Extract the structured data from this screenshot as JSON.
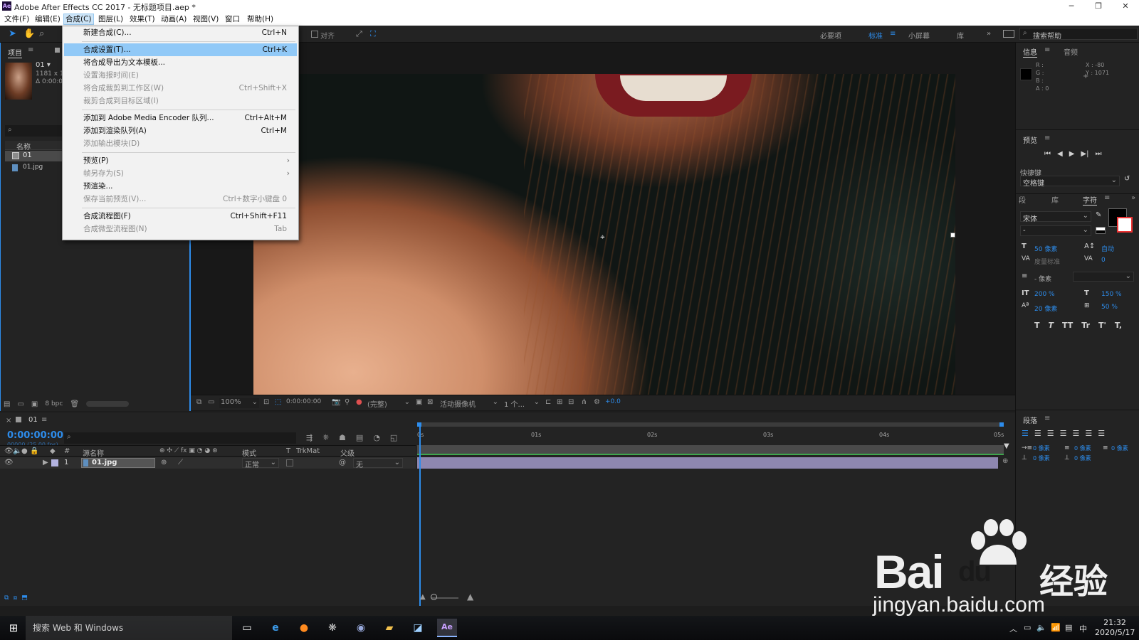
{
  "window": {
    "app_icon": "Ae",
    "title": "Adobe After Effects CC 2017 - 无标题项目.aep *",
    "minimize": "─",
    "maximize": "❐",
    "close": "✕"
  },
  "menubar": [
    "文件(F)",
    "编辑(E)",
    "合成(C)",
    "图层(L)",
    "效果(T)",
    "动画(A)",
    "视图(V)",
    "窗口",
    "帮助(H)"
  ],
  "toolbar": {
    "align_label": "对齐",
    "workspaces": [
      "必要项",
      "标准",
      "小屏幕",
      "库"
    ],
    "search_placeholder": "搜索帮助"
  },
  "composition_menu": {
    "items": [
      {
        "label": "新建合成(C)...",
        "shortcut": "Ctrl+N",
        "disabled": false
      },
      {
        "label": "合成设置(T)...",
        "shortcut": "Ctrl+K",
        "disabled": false,
        "highlighted": true
      },
      {
        "label": "将合成导出为文本模板...",
        "shortcut": "",
        "disabled": false
      },
      {
        "label": "设置海报时间(E)",
        "shortcut": "",
        "disabled": true
      },
      {
        "label": "将合成裁剪到工作区(W)",
        "shortcut": "Ctrl+Shift+X",
        "disabled": true
      },
      {
        "label": "裁剪合成到目标区域(I)",
        "shortcut": "",
        "disabled": true
      },
      {
        "label": "添加到 Adobe Media Encoder 队列...",
        "shortcut": "Ctrl+Alt+M",
        "disabled": false
      },
      {
        "label": "添加到渲染队列(A)",
        "shortcut": "Ctrl+M",
        "disabled": false
      },
      {
        "label": "添加输出模块(D)",
        "shortcut": "",
        "disabled": true
      },
      {
        "label": "预览(P)",
        "shortcut": "",
        "disabled": false,
        "submenu": true
      },
      {
        "label": "帧另存为(S)",
        "shortcut": "",
        "disabled": true,
        "submenu": true
      },
      {
        "label": "预渲染...",
        "shortcut": "",
        "disabled": false
      },
      {
        "label": "保存当前预览(V)...",
        "shortcut": "Ctrl+数字小键盘 0",
        "disabled": true
      },
      {
        "label": "合成流程图(F)",
        "shortcut": "Ctrl+Shift+F11",
        "disabled": false
      },
      {
        "label": "合成微型流程图(N)",
        "shortcut": "Tab",
        "disabled": true
      }
    ]
  },
  "project_panel": {
    "tab": "项目",
    "comp_name": "01 ▾",
    "comp_size": "1181 x 16",
    "comp_duration": "Δ 0:00:0",
    "name_header": "名称",
    "items": [
      {
        "name": "01",
        "type": "composition"
      },
      {
        "name": "01.jpg",
        "type": "image"
      }
    ],
    "bpc": "8 bpc"
  },
  "viewer_controls": {
    "zoom": "100%",
    "timecode": "0:00:00:00",
    "resolution": "(完整)",
    "camera": "活动摄像机",
    "views": "1 个...",
    "exposure": "+0.0"
  },
  "timeline": {
    "comp_tab": "01",
    "timecode": "0:00:00:00",
    "frame_info": "00000 (25.00 fps)",
    "columns": {
      "source_name": "源名称",
      "mode": "模式",
      "trkmat": "TrkMat",
      "parent": "父级",
      "track_t": "T"
    },
    "layers": [
      {
        "index": "1",
        "name": "01.jpg",
        "mode": "正常",
        "parent": "无"
      }
    ],
    "ruler": [
      "0s",
      "01s",
      "02s",
      "03s",
      "04s",
      "05s"
    ]
  },
  "info_panel": {
    "tabs": [
      "信息",
      "音频"
    ],
    "r": "R :",
    "g": "G :",
    "b": "B :",
    "a": "A : 0",
    "x": "X : -80",
    "y": "Y : 1071"
  },
  "preview_panel": {
    "title": "预览",
    "shortcut_label": "快捷键",
    "shortcut_value": "空格键"
  },
  "character_panel": {
    "tabs": [
      "段",
      "库",
      "字符"
    ],
    "font": "宋体",
    "style": "-",
    "size": "50 像素",
    "leading": "自动",
    "kerning": "度量标准",
    "tracking": "0",
    "stroke": "- 像素",
    "vscale": "200 %",
    "hscale": "150 %",
    "baseline": "20 像素",
    "tsume": "50 %",
    "styles": [
      "T",
      "T",
      "TT",
      "Tr",
      "T'",
      "T,"
    ]
  },
  "paragraph_panel": {
    "title": "段落",
    "indent_left": "0 像素",
    "indent_first": "0 像素",
    "indent_right": "0 像素",
    "space_before": "0 像素",
    "space_after": "0 像素"
  },
  "taskbar": {
    "search": "搜索 Web 和 Windows",
    "ime": "中",
    "time": "21:32",
    "date": "2020/5/17"
  },
  "watermark": {
    "brand": "Bai",
    "brand_suffix": "du",
    "cn": "经验",
    "url": "jingyan.baidu.com"
  }
}
